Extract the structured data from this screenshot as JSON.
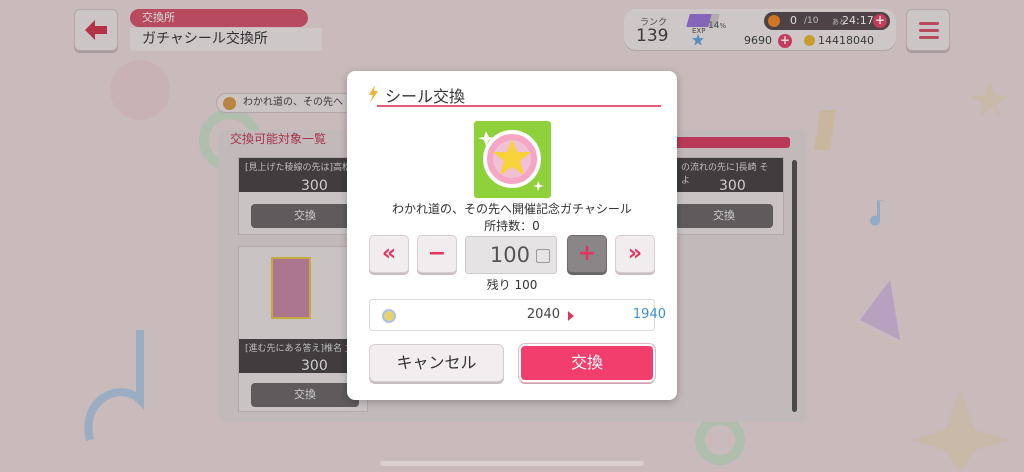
{
  "header": {
    "category": "交換所",
    "title": "ガチャシール交換所",
    "back_icon": "arrow-left-icon",
    "menu_icon": "hamburger-icon"
  },
  "status": {
    "rank_label": "ランク",
    "rank_value": "139",
    "exp_label": "EXP",
    "exp_percent": "14",
    "exp_percent_sign": "%",
    "stamina_current": "0",
    "stamina_max": "/10",
    "stamina_timer_label": "あと",
    "stamina_timer": "24:17",
    "stars": "9690",
    "coins": "14418040"
  },
  "background": {
    "event_chip": "わかれ道の、その先へ",
    "list_tab": "交換可能対象一覧",
    "cards": [
      {
        "title": "[見上げた稜線の先は]高松",
        "price": "300",
        "button": "交換"
      },
      {
        "title": "の流れの先に]長崎 そよ",
        "price": "300",
        "button": "交換"
      },
      {
        "title": "[進む先にある答え]椎名 立",
        "price": "300",
        "button": "交換"
      }
    ]
  },
  "dialog": {
    "title": "シール交換",
    "item_name": "わかれ道の、その先へ開催記念ガチャシール",
    "owned": "所持数：0",
    "btn_min": "«",
    "btn_minus": "−",
    "quantity": "100",
    "btn_plus": "+",
    "btn_max": "»",
    "remaining": "残り 100",
    "cost_from": "2040",
    "cost_to": "1940",
    "cancel": "キャンセル",
    "exchange": "交換"
  },
  "colors": {
    "accent": "#f23e6d",
    "title_bar": "#d7576f",
    "cost_after": "#3b8fd8"
  }
}
